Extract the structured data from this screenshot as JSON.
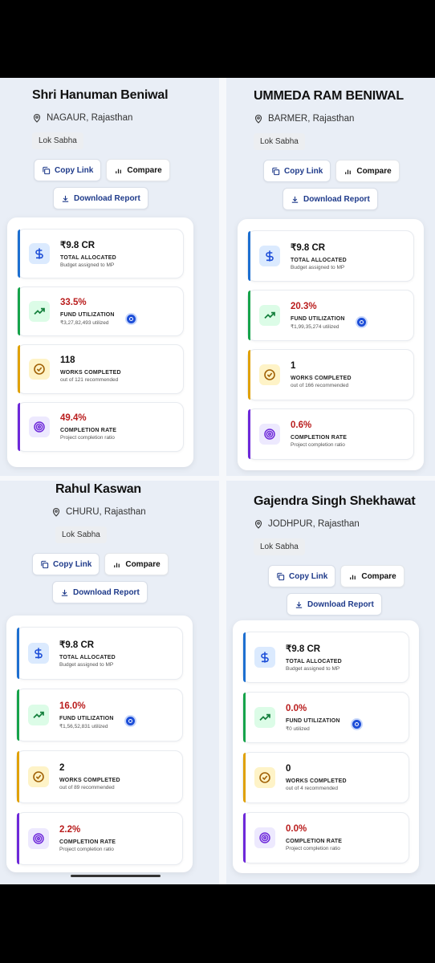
{
  "labels": {
    "copy_link": "Copy Link",
    "compare": "Compare",
    "download_report": "Download Report",
    "total_allocated": "TOTAL ALLOCATED",
    "allocated_sub": "Budget assigned to MP",
    "fund_utilization": "FUND UTILIZATION",
    "works_completed": "WORKS COMPLETED",
    "completion_rate": "COMPLETION RATE",
    "completion_sub": "Project completion ratio"
  },
  "colors": {
    "blue": "#1d6fd0",
    "green": "#16a34a",
    "amber": "#e0a106",
    "purple": "#6d28d9",
    "value_red": "#b91c1c"
  },
  "mps": [
    {
      "name": "Shri Hanuman Beniwal",
      "location": "NAGAUR, Rajasthan",
      "house": "Lok Sabha",
      "allocated": "₹9.8 CR",
      "utilization": "33.5%",
      "utilized_amount": "₹3,27,82,493 utilized",
      "works": "118",
      "works_sub": "out of 121 recommended",
      "rate": "49.4%"
    },
    {
      "name": "UMMEDA RAM BENIWAL",
      "location": "BARMER, Rajasthan",
      "house": "Lok Sabha",
      "allocated": "₹9.8 CR",
      "utilization": "20.3%",
      "utilized_amount": "₹1,99,35,274 utilized",
      "works": "1",
      "works_sub": "out of 166 recommended",
      "rate": "0.6%"
    },
    {
      "name": "Rahul Kaswan",
      "location": "CHURU, Rajasthan",
      "house": "Lok Sabha",
      "allocated": "₹9.8 CR",
      "utilization": "16.0%",
      "utilized_amount": "₹1,56,52,831 utilized",
      "works": "2",
      "works_sub": "out of 89 recommended",
      "rate": "2.2%"
    },
    {
      "name": "Gajendra Singh Shekhawat",
      "location": "JODHPUR, Rajasthan",
      "house": "Lok Sabha",
      "allocated": "₹9.8 CR",
      "utilization": "0.0%",
      "utilized_amount": "₹0 utilized",
      "works": "0",
      "works_sub": "out of 4 recommended",
      "rate": "0.0%"
    }
  ]
}
